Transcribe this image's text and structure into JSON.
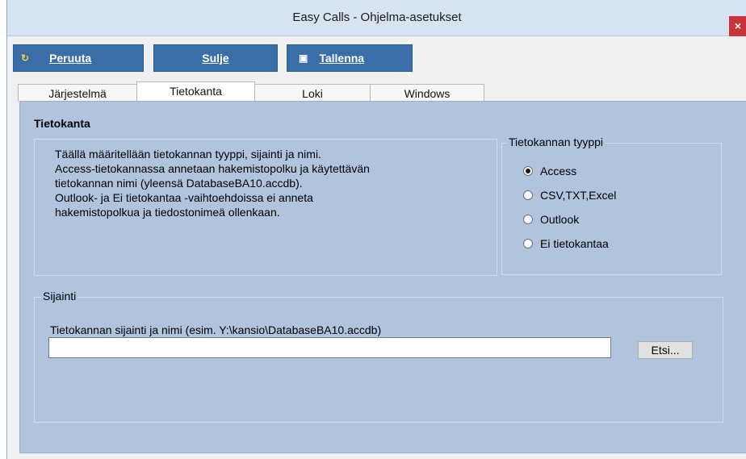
{
  "window": {
    "title": "Easy Calls - Ohjelma-asetukset",
    "close_glyph": "×"
  },
  "toolbar": {
    "cancel": {
      "icon": "refresh-icon",
      "icon_glyph": "↻",
      "label": "Peruuta"
    },
    "close": {
      "label": "Sulje"
    },
    "save": {
      "icon": "floppy-disk-icon",
      "icon_glyph": "▣",
      "label": "Tallenna"
    }
  },
  "tabs": [
    {
      "label": "Järjestelmä",
      "active": false
    },
    {
      "label": "Tietokanta",
      "active": true
    },
    {
      "label": "Loki",
      "active": false
    },
    {
      "label": "Windows",
      "active": false
    }
  ],
  "panel": {
    "section_title": "Tietokanta",
    "description_lines": [
      "Täällä määritellään tietokannan tyyppi, sijainti ja nimi.",
      "Access-tietokannassa annetaan hakemistopolku ja käytettävän",
      "tietokannan nimi (yleensä DatabaseBA10.accdb).",
      "Outlook- ja Ei tietokantaa -vaihtoehdoissa ei anneta",
      "hakemistopolkua ja tiedostonimeä ollenkaan."
    ],
    "db_type": {
      "legend": "Tietokannan tyyppi",
      "options": [
        "Access",
        "CSV,TXT,Excel",
        "Outlook",
        "Ei tietokantaa"
      ],
      "selected": "Access"
    },
    "location": {
      "legend": "Sijainti",
      "field_label": "Tietokannan sijainti ja nimi (esim. Y:\\kansio\\DatabaseBA10.accdb)",
      "value": "",
      "browse_label": "Etsi..."
    }
  },
  "colors": {
    "toolbar_button": "#3a6ea9",
    "panel_background": "#b0c4de",
    "close_button": "#c7343a",
    "titlebar": "#d7e3f1"
  }
}
